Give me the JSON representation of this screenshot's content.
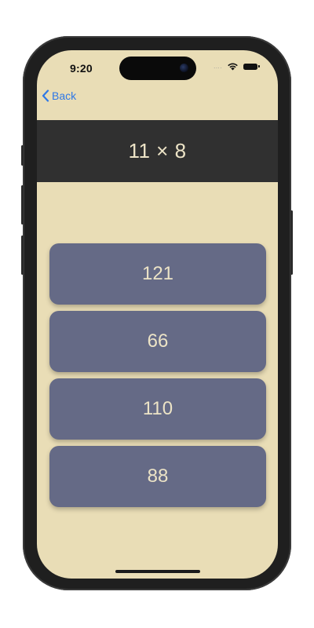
{
  "status_bar": {
    "time": "9:20",
    "signal_dots": "....",
    "icons": [
      "wifi-icon",
      "battery-icon"
    ]
  },
  "nav": {
    "back_label": "Back",
    "back_icon": "chevron-left-icon"
  },
  "quiz": {
    "question": "11 × 8",
    "answers": [
      "121",
      "66",
      "110",
      "88"
    ]
  },
  "colors": {
    "background": "#e9ddb6",
    "header_bar": "#303030",
    "answer_button": "#656a86",
    "text_light": "#ece3c6",
    "link_blue": "#2f78e6"
  }
}
